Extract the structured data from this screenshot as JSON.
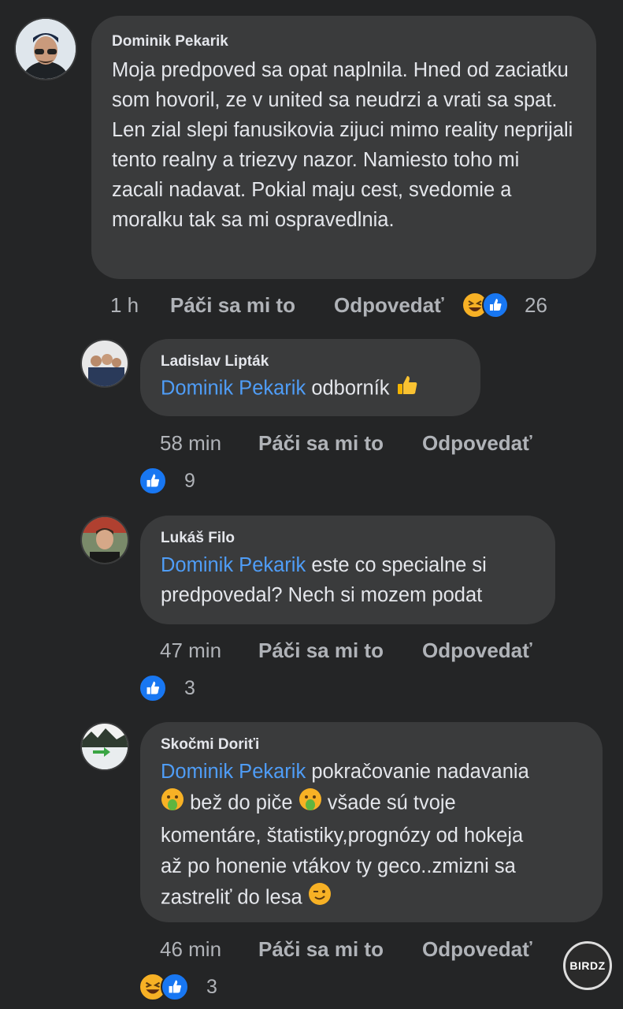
{
  "comments": [
    {
      "author": "Dominik Pekarik",
      "text": "Moja predpoved sa opat naplnila. Hned od zaciatku som hovoril, ze v united sa neudrzi a vrati sa spat. Len zial slepi fanusikovia zijuci mimo reality neprijali tento realny a triezvy nazor. Namiesto toho mi zacali nadavat. Pokial maju cest, svedomie a moralku tak sa mi ospravedlnia.",
      "time": "1 h",
      "like_label": "Páči sa mi to",
      "reply_label": "Odpovedať",
      "reaction_count": "26"
    },
    {
      "author": "Ladislav Lipták",
      "mention": "Dominik Pekarik",
      "text": "odborník",
      "time": "58 min",
      "like_label": "Páči sa mi to",
      "reply_label": "Odpovedať",
      "reaction_count": "9"
    },
    {
      "author": "Lukáš Filo",
      "mention": "Dominik Pekarik",
      "text_line1": "este co specialne si",
      "text_line2": "predpovedal? Nech si mozem podat",
      "time": "47 min",
      "like_label": "Páči sa mi to",
      "reply_label": "Odpovedať",
      "reaction_count": "3"
    },
    {
      "author": "Skočmi Doriťi",
      "mention": "Dominik Pekarik",
      "text_a": "pokračovanie nadavania",
      "text_b": "bež do piče",
      "text_c": "všade sú tvoje",
      "text_d": "komentáre, štatistiky,prognózy od hokeja",
      "text_e": "až po honenie vtákov ty geco..zmizni sa",
      "text_f": "zastreliť do lesa",
      "time": "46 min",
      "like_label": "Páči sa mi to",
      "reply_label": "Odpovedať",
      "reaction_count": "3"
    }
  ],
  "watermark": "BIRDZ",
  "colors": {
    "background": "#242526",
    "bubble": "#3a3b3c",
    "mention": "#4f9df7",
    "like_blue": "#1877f2",
    "haha_yellow": "#f7b125"
  }
}
